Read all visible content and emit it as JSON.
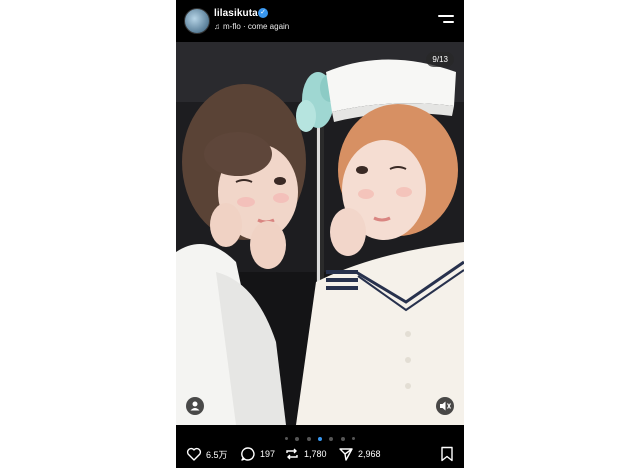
{
  "post": {
    "username": "lilasikuta",
    "music": "m-flo · come again",
    "counter": "9/13"
  },
  "carousel": {
    "total_dots": 7,
    "active_index": 3
  },
  "actions": {
    "likes": "6.5万",
    "comments": "197",
    "reposts": "1,780",
    "shares": "2,968"
  },
  "colors": {
    "accent": "#3897f0",
    "background": "#000000"
  },
  "icons": [
    "avatar",
    "verified-badge-icon",
    "music-note-icon",
    "menu-icon",
    "person-tag-icon",
    "mute-icon",
    "heart-icon",
    "comment-icon",
    "repost-icon",
    "share-icon",
    "bookmark-icon"
  ]
}
